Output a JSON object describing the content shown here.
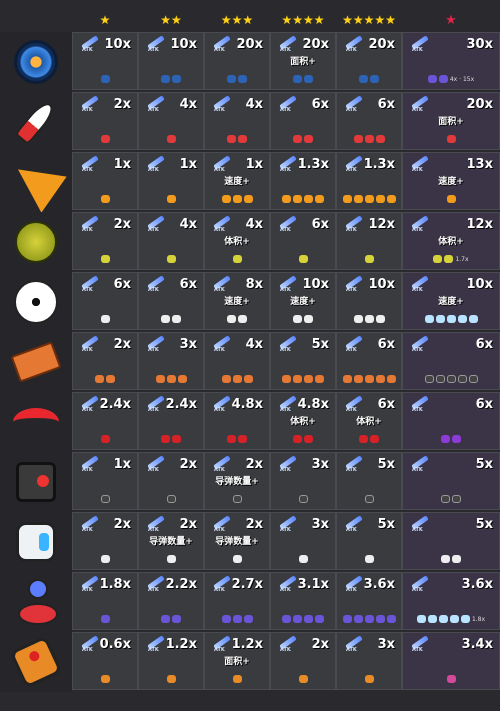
{
  "header": {
    "cols": [
      {
        "stars": "★",
        "cls": "star"
      },
      {
        "stars": "★★",
        "cls": "star"
      },
      {
        "stars": "★★★",
        "cls": "star"
      },
      {
        "stars": "★★★★",
        "cls": "star"
      },
      {
        "stars": "★★★★★",
        "cls": "star"
      },
      {
        "stars": "★",
        "cls": "redstar"
      }
    ]
  },
  "atk_label": "ATK",
  "rows": [
    {
      "icon": "gyro",
      "mini": "c-blue",
      "cells": [
        {
          "m": "10x",
          "note": "",
          "n": 1
        },
        {
          "m": "10x",
          "note": "",
          "n": 2
        },
        {
          "m": "20x",
          "note": "",
          "n": 2
        },
        {
          "m": "20x",
          "note": "面积+",
          "n": 2
        },
        {
          "m": "20x",
          "note": "",
          "n": 2
        },
        {
          "m": "30x",
          "note": "",
          "n": 2,
          "extra": "4x · 15x",
          "mini2": "c-purple"
        }
      ]
    },
    {
      "icon": "rocket",
      "mini": "c-red",
      "cells": [
        {
          "m": "2x",
          "note": "",
          "n": 1
        },
        {
          "m": "4x",
          "note": "",
          "n": 1
        },
        {
          "m": "4x",
          "note": "",
          "n": 2
        },
        {
          "m": "6x",
          "note": "",
          "n": 2
        },
        {
          "m": "6x",
          "note": "",
          "n": 3
        },
        {
          "m": "20x",
          "note": "面积+",
          "n": 1
        }
      ]
    },
    {
      "icon": "drill",
      "mini": "c-orange",
      "cells": [
        {
          "m": "1x",
          "note": "",
          "n": 1
        },
        {
          "m": "1x",
          "note": "",
          "n": 1
        },
        {
          "m": "1x",
          "note": "速度+",
          "n": 3
        },
        {
          "m": "1.3x",
          "note": "",
          "n": 4
        },
        {
          "m": "1.3x",
          "note": "",
          "n": 5
        },
        {
          "m": "13x",
          "note": "速度+",
          "n": 1
        }
      ]
    },
    {
      "icon": "durian",
      "mini": "c-yellow",
      "cells": [
        {
          "m": "2x",
          "note": "",
          "n": 1
        },
        {
          "m": "4x",
          "note": "",
          "n": 1
        },
        {
          "m": "4x",
          "note": "体积+",
          "n": 1
        },
        {
          "m": "6x",
          "note": "",
          "n": 1
        },
        {
          "m": "12x",
          "note": "",
          "n": 1
        },
        {
          "m": "12x",
          "note": "体积+",
          "n": 2,
          "extra": "1.7x"
        }
      ]
    },
    {
      "icon": "ball",
      "mini": "c-white",
      "cells": [
        {
          "m": "6x",
          "note": "",
          "n": 1
        },
        {
          "m": "6x",
          "note": "",
          "n": 2
        },
        {
          "m": "8x",
          "note": "速度+",
          "n": 2
        },
        {
          "m": "10x",
          "note": "速度+",
          "n": 2
        },
        {
          "m": "10x",
          "note": "",
          "n": 3
        },
        {
          "m": "10x",
          "note": "速度+",
          "n": 5,
          "mini2": "c-cyan"
        }
      ]
    },
    {
      "icon": "brick",
      "mini": "c-brick",
      "cells": [
        {
          "m": "2x",
          "note": "",
          "n": 2
        },
        {
          "m": "3x",
          "note": "",
          "n": 3
        },
        {
          "m": "4x",
          "note": "",
          "n": 3
        },
        {
          "m": "5x",
          "note": "",
          "n": 4
        },
        {
          "m": "6x",
          "note": "",
          "n": 5
        },
        {
          "m": "6x",
          "note": "",
          "n": 5,
          "mini2": "c-dark"
        }
      ]
    },
    {
      "icon": "boomer",
      "mini": "c-crim",
      "cells": [
        {
          "m": "2.4x",
          "note": "",
          "n": 1
        },
        {
          "m": "2.4x",
          "note": "",
          "n": 2
        },
        {
          "m": "4.8x",
          "note": "",
          "n": 2
        },
        {
          "m": "4.8x",
          "note": "体积+",
          "n": 2
        },
        {
          "m": "6x",
          "note": "体积+",
          "n": 2
        },
        {
          "m": "6x",
          "note": "",
          "n": 2,
          "mini2": "c-violet"
        }
      ]
    },
    {
      "icon": "robot",
      "mini": "c-dark",
      "cells": [
        {
          "m": "1x",
          "note": "",
          "n": 1
        },
        {
          "m": "2x",
          "note": "",
          "n": 1
        },
        {
          "m": "2x",
          "note": "导弹数量+",
          "n": 1
        },
        {
          "m": "3x",
          "note": "",
          "n": 1
        },
        {
          "m": "5x",
          "note": "",
          "n": 1
        },
        {
          "m": "5x",
          "note": "",
          "n": 2
        }
      ]
    },
    {
      "icon": "pod",
      "mini": "c-white",
      "cells": [
        {
          "m": "2x",
          "note": "",
          "n": 1
        },
        {
          "m": "2x",
          "note": "导弹数量+",
          "n": 1
        },
        {
          "m": "2x",
          "note": "导弹数量+",
          "n": 1
        },
        {
          "m": "3x",
          "note": "",
          "n": 1
        },
        {
          "m": "5x",
          "note": "",
          "n": 1
        },
        {
          "m": "5x",
          "note": "",
          "n": 2
        }
      ]
    },
    {
      "icon": "lamp",
      "mini": "c-purple",
      "cells": [
        {
          "m": "1.8x",
          "note": "",
          "n": 1
        },
        {
          "m": "2.2x",
          "note": "",
          "n": 2
        },
        {
          "m": "2.7x",
          "note": "",
          "n": 3
        },
        {
          "m": "3.1x",
          "note": "",
          "n": 4
        },
        {
          "m": "3.6x",
          "note": "",
          "n": 5
        },
        {
          "m": "3.6x",
          "note": "",
          "n": 5,
          "extra": "1.8x",
          "mini2": "c-cyan"
        }
      ]
    },
    {
      "icon": "joy",
      "mini": "c-joy",
      "cells": [
        {
          "m": "0.6x",
          "note": "",
          "n": 1
        },
        {
          "m": "1.2x",
          "note": "",
          "n": 1
        },
        {
          "m": "1.2x",
          "note": "面积+",
          "n": 1
        },
        {
          "m": "2x",
          "note": "",
          "n": 1
        },
        {
          "m": "3x",
          "note": "",
          "n": 1
        },
        {
          "m": "3.4x",
          "note": "",
          "n": 1,
          "mini2": "c-pink"
        }
      ]
    }
  ]
}
